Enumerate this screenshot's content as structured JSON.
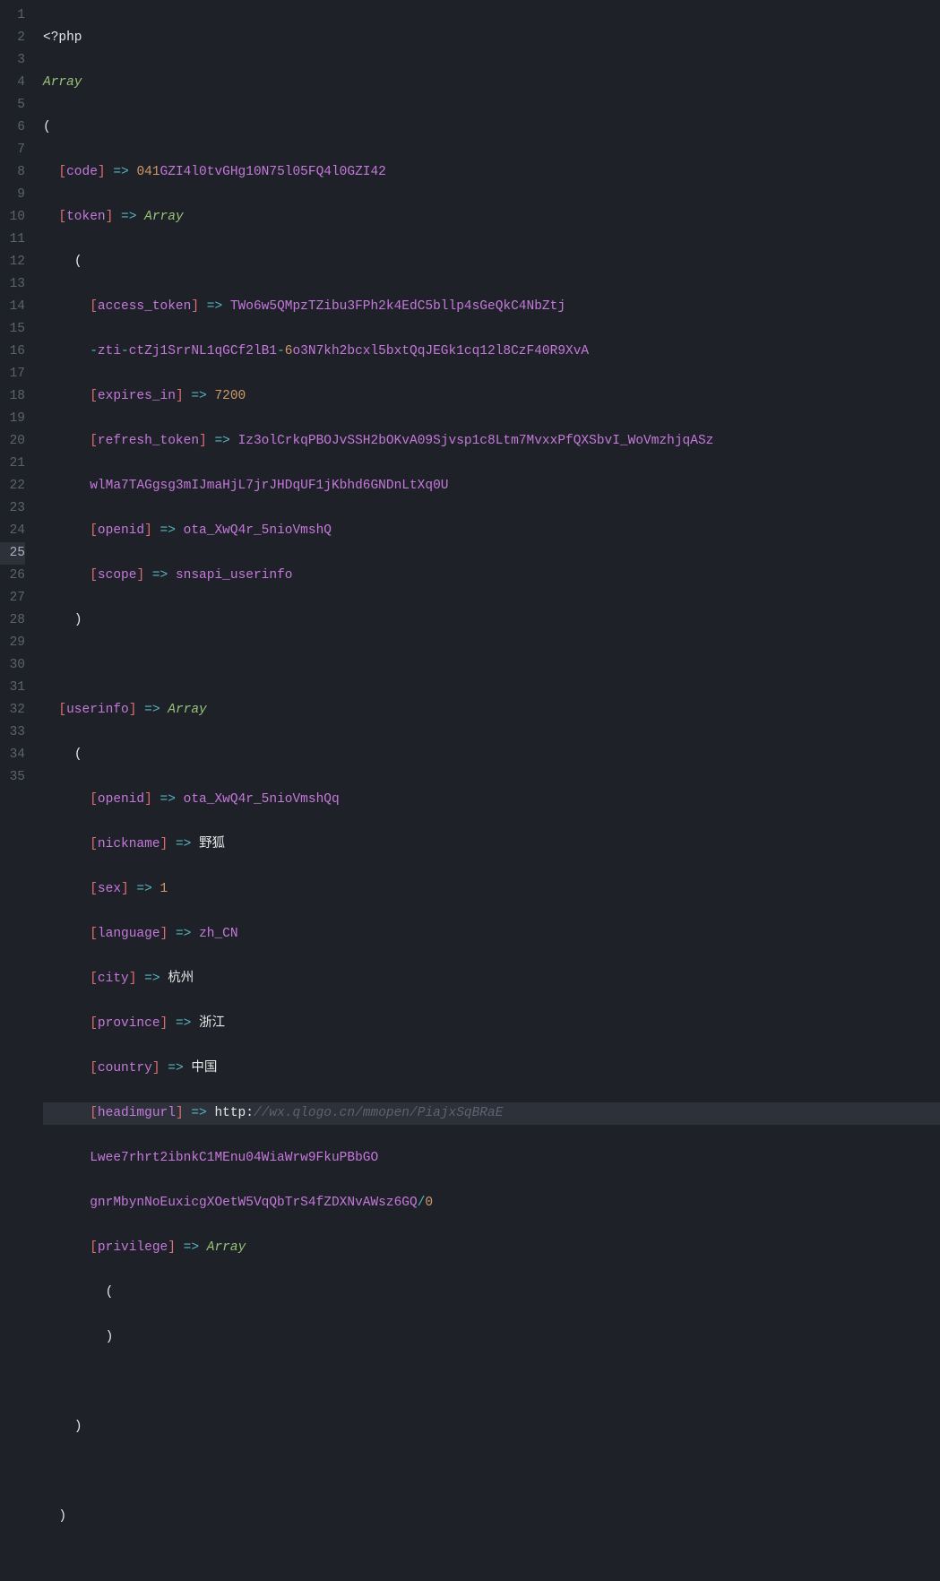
{
  "gutter": {
    "start": 1,
    "end": 35,
    "active": 25
  },
  "tokens": {
    "php_open": "<?php",
    "array_kw": "Array",
    "arrow": " => ",
    "lparen": "(",
    "rparen": ")",
    "lbrack": "[",
    "rbrack": "]"
  },
  "code": {
    "code_key": "code",
    "code_val_num": "041",
    "code_val_rest": "GZI4l0tvGHg10N75l05FQ4l0GZI42",
    "token_key": "token",
    "access_token_key": "access_token",
    "access_token_val1": "TWo6w5QMpzTZibu3FPh2k4EdC5bllp4sGeQkC4NbZtj",
    "access_token_val2a": "zti",
    "access_token_val2b": "ctZj1SrrNL1qGCf2lB1",
    "access_token_val2c": "6",
    "access_token_val2d": "o3N7kh2bcxl5bxtQqJEGk1cq12l8CzF40R9XvA",
    "expires_in_key": "expires_in",
    "expires_in_val": "7200",
    "refresh_token_key": "refresh_token",
    "refresh_token_val1": "Iz3olCrkqPBOJvSSH2bOKvA09Sjvsp1c8Ltm7MvxxPfQXSbvI_WoVmzhjqASz",
    "refresh_token_val2": "wlMa7TAGgsg3mIJmaHjL7jrJHDqUF1jKbhd6GNDnLtXq0U",
    "openid_key": "openid",
    "openid_val": "ota_XwQ4r_5nioVmshQ",
    "scope_key": "scope",
    "scope_val": "snsapi_userinfo",
    "userinfo_key": "userinfo",
    "ui_openid_key": "openid",
    "ui_openid_val": "ota_XwQ4r_5nioVmshQq",
    "nickname_key": "nickname",
    "nickname_val": "野狐",
    "sex_key": "sex",
    "sex_val": "1",
    "language_key": "language",
    "language_val": "zh_CN",
    "city_key": "city",
    "city_val": "杭州",
    "province_key": "province",
    "province_val": "浙江",
    "country_key": "country",
    "country_val": "中国",
    "headimgurl_key": "headimgurl",
    "headimgurl_proto": "http:",
    "headimgurl_path1": "//wx.qlogo.cn/mmopen/PiajxSqBRaE",
    "headimgurl_path2": "Lwee7rhrt2ibnkC1MEnu04WiaWrw9FkuPBbGO",
    "headimgurl_path3": "gnrMbynNoEuxicgXOetW5VqQbTrS4fZDXNvAWsz6GQ",
    "headimgurl_slash": "/",
    "headimgurl_zero": "0",
    "privilege_key": "privilege"
  }
}
